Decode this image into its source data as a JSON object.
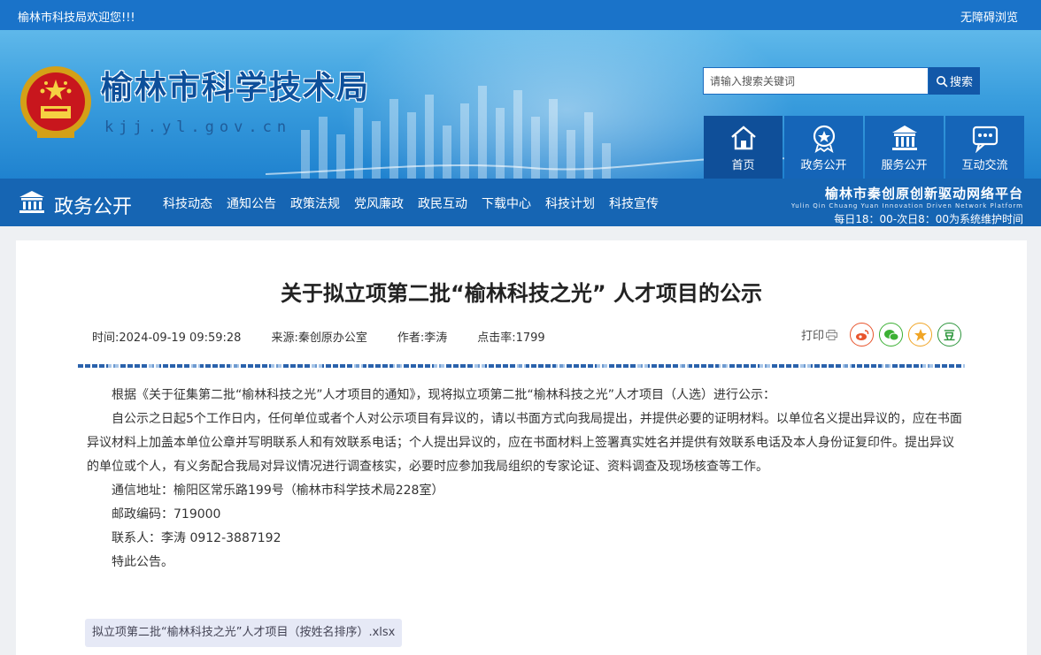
{
  "topbar": {
    "welcome": "榆林市科技局欢迎您!!!",
    "accessibility": "无障碍浏览"
  },
  "header": {
    "site_title": "榆林市科学技术局",
    "domain": "kjj.yl.gov.cn"
  },
  "search": {
    "placeholder": "请输入搜索关键词",
    "button": "搜索"
  },
  "quicknav": [
    {
      "label": "首页",
      "icon": "home-icon"
    },
    {
      "label": "政务公开",
      "icon": "badge-icon"
    },
    {
      "label": "服务公开",
      "icon": "building-icon"
    },
    {
      "label": "互动交流",
      "icon": "chat-icon"
    }
  ],
  "mainnav": {
    "section_title": "政务公开",
    "links": [
      "科技动态",
      "通知公告",
      "政策法规",
      "党风廉政",
      "政民互动",
      "下载中心",
      "科技计划",
      "科技宣传"
    ],
    "platform_title": "榆林市秦创原创新驱动网络平台",
    "platform_en": "Yulin Qin Chuang Yuan Innovation Driven Network Platform",
    "maintenance": "每日18：00-次日8：00为系统维护时间"
  },
  "article": {
    "title": "关于拟立项第二批“榆林科技之光” 人才项目的公示",
    "time": "时间:2024-09-19 09:59:28",
    "source": "来源:秦创原办公室",
    "author": "作者:李涛",
    "views": "点击率:1799",
    "print": "打印",
    "paragraphs": [
      "根据《关于征集第二批“榆林科技之光”人才项目的通知》，现将拟立项第二批“榆林科技之光”人才项目（人选）进行公示：",
      "自公示之日起5个工作日内，任何单位或者个人对公示项目有异议的，请以书面方式向我局提出，并提供必要的证明材料。以单位名义提出异议的，应在书面异议材料上加盖本单位公章并写明联系人和有效联系电话；个人提出异议的，应在书面材料上签署真实姓名并提供有效联系电话及本人身份证复印件。提出异议的单位或个人，有义务配合我局对异议情况进行调查核实，必要时应参加我局组织的专家论证、资料调查及现场核查等工作。",
      "通信地址：榆阳区常乐路199号（榆林市科学技术局228室）",
      "邮政编码：719000",
      "联系人：李涛 0912-3887192",
      "特此公告。"
    ],
    "attachment": "拟立项第二批“榆林科技之光”人才项目（按姓名排序）.xlsx"
  },
  "share_icons": [
    "weibo-icon",
    "wechat-icon",
    "qzone-icon",
    "douban-icon"
  ],
  "share_douban_glyph": "豆",
  "colors": {
    "primary": "#1665b3",
    "dark": "#0f4f99",
    "weibo": "#e8552d",
    "wechat": "#3cb034",
    "qzone": "#f0a526",
    "douban": "#2e963d"
  }
}
